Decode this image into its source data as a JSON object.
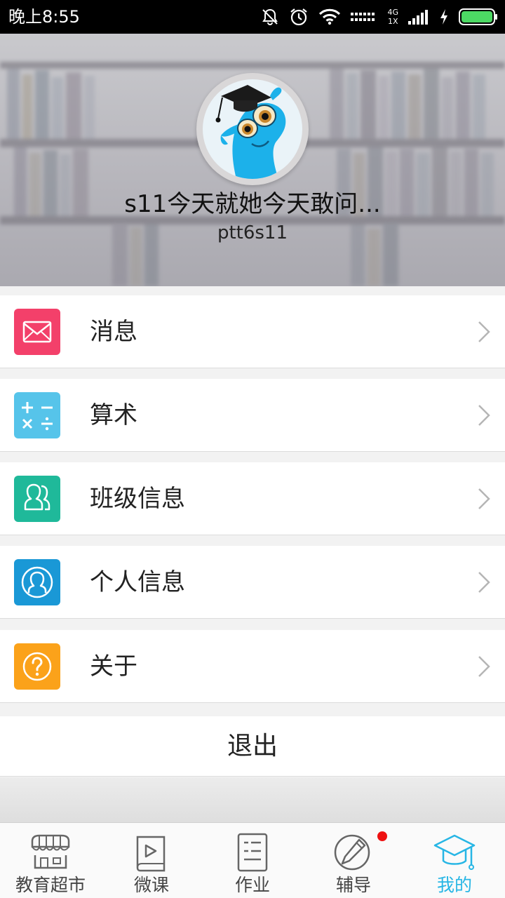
{
  "status_bar": {
    "time": "晚上8:55",
    "network_top": "4G",
    "network_bottom": "1X",
    "icons": [
      "mute-icon",
      "alarm-icon",
      "wifi-icon",
      "signal-icon",
      "charging-icon",
      "battery-icon"
    ]
  },
  "profile": {
    "name": "s11今天就她今天敢问...",
    "user_id": "ptt6s11",
    "avatar": "cartoon-mascot-avatar"
  },
  "menu": {
    "items": [
      {
        "label": "消息",
        "icon": "envelope-icon",
        "color": "#f3406a"
      },
      {
        "label": "算术",
        "icon": "arithmetic-icon",
        "color": "#56c4ea"
      },
      {
        "label": "班级信息",
        "icon": "group-icon",
        "color": "#1fb99a"
      },
      {
        "label": "个人信息",
        "icon": "person-icon",
        "color": "#1a98d6"
      },
      {
        "label": "关于",
        "icon": "question-icon",
        "color": "#fba21a"
      }
    ],
    "logout_label": "退出"
  },
  "tab_bar": {
    "tabs": [
      {
        "label": "教育超市",
        "icon": "store-icon",
        "active": false
      },
      {
        "label": "微课",
        "icon": "video-book-icon",
        "active": false
      },
      {
        "label": "作业",
        "icon": "document-icon",
        "active": false
      },
      {
        "label": "辅导",
        "icon": "pencil-icon",
        "active": false,
        "badge": true
      },
      {
        "label": "我的",
        "icon": "graduation-cap-icon",
        "active": true
      }
    ],
    "active_color": "#27b6e5",
    "badge_color": "#ee1111"
  }
}
